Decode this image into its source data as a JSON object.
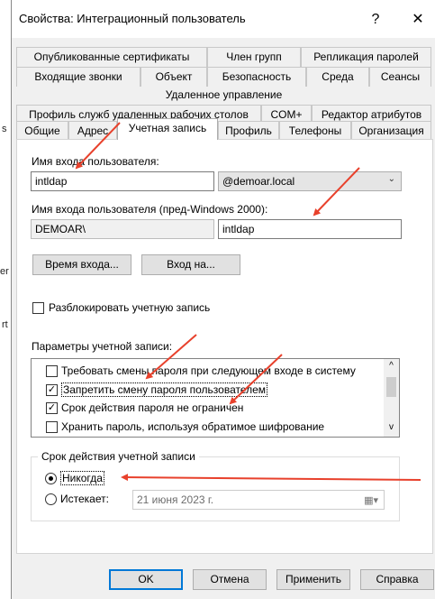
{
  "window": {
    "title": "Свойства: Интеграционный пользователь",
    "help_glyph": "?",
    "close_glyph": "✕"
  },
  "left_edge": {
    "glyph1": "s",
    "glyph2": "er",
    "glyph3": "rt"
  },
  "tabs": {
    "row1": [
      "Опубликованные сертификаты",
      "Член групп",
      "Репликация паролей"
    ],
    "row2": [
      "Входящие звонки",
      "Объект",
      "Безопасность",
      "Среда",
      "Сеансы"
    ],
    "row3": [
      "Удаленное управление"
    ],
    "row4": [
      "Профиль служб удаленных рабочих столов",
      "COM+",
      "Редактор атрибутов"
    ],
    "row5": [
      "Общие",
      "Адрес",
      "Учетная запись",
      "Профиль",
      "Телефоны",
      "Организация"
    ],
    "active": "Учетная запись"
  },
  "account": {
    "logon_name_label": "Имя входа пользователя:",
    "logon_name_value": "intldap",
    "domain_value": "@demoar.local",
    "pre2000_label": "Имя входа пользователя (пред-Windows 2000):",
    "pre2000_domain": "DEMOAR\\",
    "pre2000_name": "intldap",
    "logon_hours_button": "Время входа...",
    "logon_to_button": "Вход на...",
    "unlock_label": "Разблокировать учетную запись",
    "options_label": "Параметры учетной записи:",
    "options": [
      {
        "label": "Требовать смены пароля при следующем входе в систему",
        "checked": false
      },
      {
        "label": "Запретить смену пароля пользователем",
        "checked": true
      },
      {
        "label": "Срок действия пароля не ограничен",
        "checked": true
      },
      {
        "label": "Хранить пароль, используя обратимое шифрование",
        "checked": false
      }
    ],
    "expires_group": "Срок действия учетной записи",
    "never_label": "Никогда",
    "expires_label": "Истекает:",
    "expires_date": "21   июня   2023 г.",
    "selected_expiry": "never"
  },
  "buttons": {
    "ok": "OK",
    "cancel": "Отмена",
    "apply": "Применить",
    "help": "Справка"
  },
  "colors": {
    "arrow": "#e8412c",
    "focus": "#0078d7"
  },
  "icons": {
    "scroll_up": "^",
    "scroll_down": "v",
    "check": "✓",
    "combo_arrow": "⌄",
    "calendar": "▦▾"
  }
}
